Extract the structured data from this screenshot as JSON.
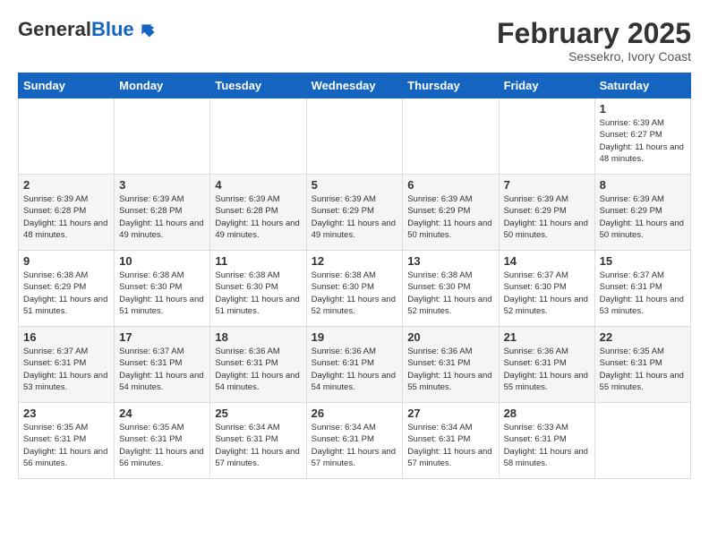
{
  "header": {
    "logo_general": "General",
    "logo_blue": "Blue",
    "month_title": "February 2025",
    "subtitle": "Sessekro, Ivory Coast"
  },
  "weekdays": [
    "Sunday",
    "Monday",
    "Tuesday",
    "Wednesday",
    "Thursday",
    "Friday",
    "Saturday"
  ],
  "weeks": [
    [
      {
        "day": "",
        "info": ""
      },
      {
        "day": "",
        "info": ""
      },
      {
        "day": "",
        "info": ""
      },
      {
        "day": "",
        "info": ""
      },
      {
        "day": "",
        "info": ""
      },
      {
        "day": "",
        "info": ""
      },
      {
        "day": "1",
        "info": "Sunrise: 6:39 AM\nSunset: 6:27 PM\nDaylight: 11 hours and 48 minutes."
      }
    ],
    [
      {
        "day": "2",
        "info": "Sunrise: 6:39 AM\nSunset: 6:28 PM\nDaylight: 11 hours and 48 minutes."
      },
      {
        "day": "3",
        "info": "Sunrise: 6:39 AM\nSunset: 6:28 PM\nDaylight: 11 hours and 49 minutes."
      },
      {
        "day": "4",
        "info": "Sunrise: 6:39 AM\nSunset: 6:28 PM\nDaylight: 11 hours and 49 minutes."
      },
      {
        "day": "5",
        "info": "Sunrise: 6:39 AM\nSunset: 6:29 PM\nDaylight: 11 hours and 49 minutes."
      },
      {
        "day": "6",
        "info": "Sunrise: 6:39 AM\nSunset: 6:29 PM\nDaylight: 11 hours and 50 minutes."
      },
      {
        "day": "7",
        "info": "Sunrise: 6:39 AM\nSunset: 6:29 PM\nDaylight: 11 hours and 50 minutes."
      },
      {
        "day": "8",
        "info": "Sunrise: 6:39 AM\nSunset: 6:29 PM\nDaylight: 11 hours and 50 minutes."
      }
    ],
    [
      {
        "day": "9",
        "info": "Sunrise: 6:38 AM\nSunset: 6:29 PM\nDaylight: 11 hours and 51 minutes."
      },
      {
        "day": "10",
        "info": "Sunrise: 6:38 AM\nSunset: 6:30 PM\nDaylight: 11 hours and 51 minutes."
      },
      {
        "day": "11",
        "info": "Sunrise: 6:38 AM\nSunset: 6:30 PM\nDaylight: 11 hours and 51 minutes."
      },
      {
        "day": "12",
        "info": "Sunrise: 6:38 AM\nSunset: 6:30 PM\nDaylight: 11 hours and 52 minutes."
      },
      {
        "day": "13",
        "info": "Sunrise: 6:38 AM\nSunset: 6:30 PM\nDaylight: 11 hours and 52 minutes."
      },
      {
        "day": "14",
        "info": "Sunrise: 6:37 AM\nSunset: 6:30 PM\nDaylight: 11 hours and 52 minutes."
      },
      {
        "day": "15",
        "info": "Sunrise: 6:37 AM\nSunset: 6:31 PM\nDaylight: 11 hours and 53 minutes."
      }
    ],
    [
      {
        "day": "16",
        "info": "Sunrise: 6:37 AM\nSunset: 6:31 PM\nDaylight: 11 hours and 53 minutes."
      },
      {
        "day": "17",
        "info": "Sunrise: 6:37 AM\nSunset: 6:31 PM\nDaylight: 11 hours and 54 minutes."
      },
      {
        "day": "18",
        "info": "Sunrise: 6:36 AM\nSunset: 6:31 PM\nDaylight: 11 hours and 54 minutes."
      },
      {
        "day": "19",
        "info": "Sunrise: 6:36 AM\nSunset: 6:31 PM\nDaylight: 11 hours and 54 minutes."
      },
      {
        "day": "20",
        "info": "Sunrise: 6:36 AM\nSunset: 6:31 PM\nDaylight: 11 hours and 55 minutes."
      },
      {
        "day": "21",
        "info": "Sunrise: 6:36 AM\nSunset: 6:31 PM\nDaylight: 11 hours and 55 minutes."
      },
      {
        "day": "22",
        "info": "Sunrise: 6:35 AM\nSunset: 6:31 PM\nDaylight: 11 hours and 55 minutes."
      }
    ],
    [
      {
        "day": "23",
        "info": "Sunrise: 6:35 AM\nSunset: 6:31 PM\nDaylight: 11 hours and 56 minutes."
      },
      {
        "day": "24",
        "info": "Sunrise: 6:35 AM\nSunset: 6:31 PM\nDaylight: 11 hours and 56 minutes."
      },
      {
        "day": "25",
        "info": "Sunrise: 6:34 AM\nSunset: 6:31 PM\nDaylight: 11 hours and 57 minutes."
      },
      {
        "day": "26",
        "info": "Sunrise: 6:34 AM\nSunset: 6:31 PM\nDaylight: 11 hours and 57 minutes."
      },
      {
        "day": "27",
        "info": "Sunrise: 6:34 AM\nSunset: 6:31 PM\nDaylight: 11 hours and 57 minutes."
      },
      {
        "day": "28",
        "info": "Sunrise: 6:33 AM\nSunset: 6:31 PM\nDaylight: 11 hours and 58 minutes."
      },
      {
        "day": "",
        "info": ""
      }
    ]
  ]
}
